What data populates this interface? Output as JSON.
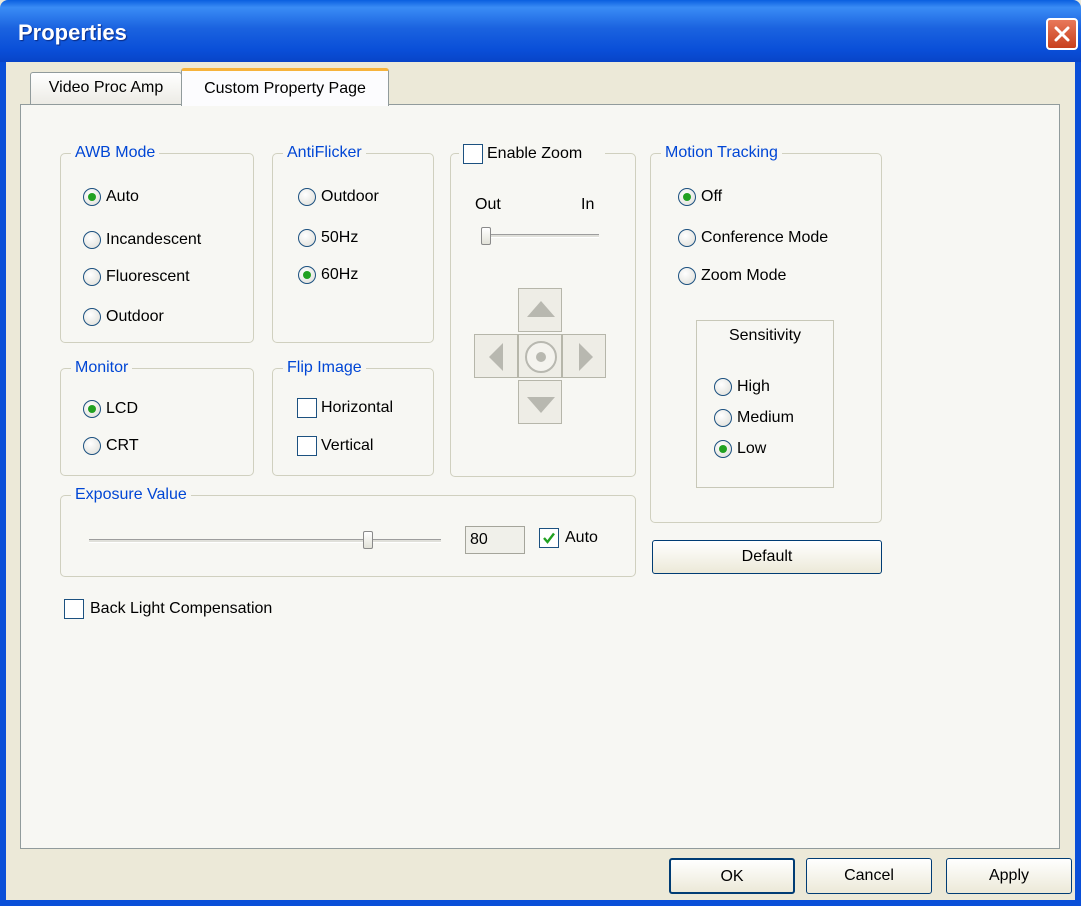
{
  "window": {
    "title": "Properties"
  },
  "tabs": [
    {
      "label": "Video Proc Amp",
      "active": false
    },
    {
      "label": "Custom Property Page",
      "active": true
    }
  ],
  "awb": {
    "legend": "AWB Mode",
    "options": [
      "Auto",
      "Incandescent",
      "Fluorescent",
      "Outdoor"
    ],
    "selected": "Auto"
  },
  "antiflicker": {
    "legend": "AntiFlicker",
    "options": [
      "Outdoor",
      "50Hz",
      "60Hz"
    ],
    "selected": "60Hz"
  },
  "zoom": {
    "enable_label": "Enable Zoom",
    "enabled": false,
    "out_label": "Out",
    "in_label": "In",
    "value": 0
  },
  "motion": {
    "legend": "Motion Tracking",
    "options": [
      "Off",
      "Conference Mode",
      "Zoom Mode"
    ],
    "selected": "Off",
    "sensitivity": {
      "legend": "Sensitivity",
      "options": [
        "High",
        "Medium",
        "Low"
      ],
      "selected": "Low"
    }
  },
  "monitor": {
    "legend": "Monitor",
    "options": [
      "LCD",
      "CRT"
    ],
    "selected": "LCD"
  },
  "flip": {
    "legend": "Flip Image",
    "horizontal_label": "Horizontal",
    "horizontal": false,
    "vertical_label": "Vertical",
    "vertical": false
  },
  "exposure": {
    "legend": "Exposure Value",
    "value": "80",
    "auto_label": "Auto",
    "auto": true,
    "slider_fraction": 0.8
  },
  "backlight": {
    "label": "Back Light Compensation",
    "checked": false
  },
  "buttons": {
    "default": "Default",
    "ok": "OK",
    "cancel": "Cancel",
    "apply": "Apply"
  },
  "colors": {
    "titlebar": "#0a4fd8",
    "legend_text": "#0046d5",
    "dialog_bg": "#ece9d8",
    "radio_dot": "#21a121"
  }
}
